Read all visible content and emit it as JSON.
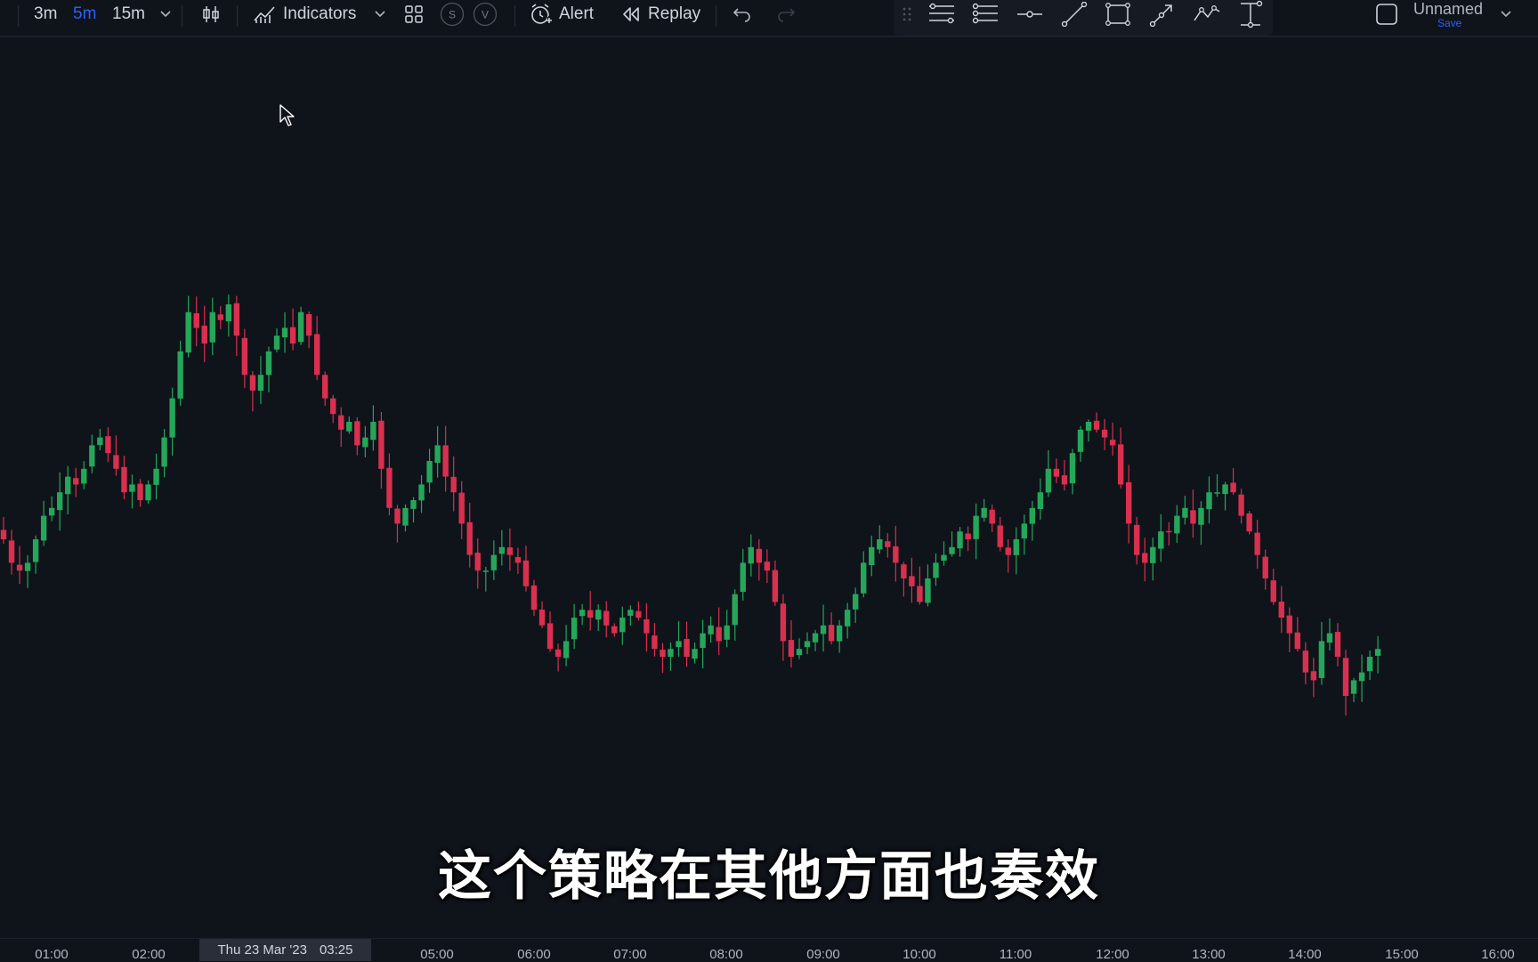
{
  "toolbar": {
    "timeframes": [
      {
        "label": "3m",
        "active": false
      },
      {
        "label": "5m",
        "active": true
      },
      {
        "label": "15m",
        "active": false
      }
    ],
    "indicators_label": "Indicators",
    "alert_label": "Alert",
    "replay_label": "Replay",
    "indicator_badges": [
      "S",
      "V"
    ]
  },
  "drawing_tools": [
    "handle-icon",
    "fib-retracement-icon",
    "pitchfork-icon",
    "horizontal-ray-icon",
    "trend-line-icon",
    "rectangle-icon",
    "arrow-line-icon",
    "path-icon",
    "fixed-range-icon"
  ],
  "layout": {
    "name": "Unnamed",
    "save_label": "Save"
  },
  "colors": {
    "up": "#26a65b",
    "down": "#d9304f",
    "background": "#0f131a",
    "accent": "#2962ff"
  },
  "time_axis": {
    "ticks": [
      "01:00",
      "02:00",
      "05:00",
      "06:00",
      "07:00",
      "08:00",
      "09:00",
      "10:00",
      "11:00",
      "12:00",
      "13:00",
      "14:00",
      "15:00",
      "16:00"
    ],
    "crosshair_date": "Thu 23 Mar '23",
    "crosshair_time": "03:25"
  },
  "subtitle": "这个策略在其他方面也奏效",
  "chart_data": {
    "type": "candlestick",
    "timeframe": "5m",
    "x_start": "00:35",
    "x_step_minutes": 5,
    "close": [
      100,
      97,
      96,
      97,
      100,
      103,
      104,
      106,
      108,
      107,
      109,
      112,
      113,
      111,
      109,
      106,
      107,
      105,
      107,
      109,
      113,
      118,
      124,
      129,
      127,
      125,
      129,
      128,
      130,
      126,
      121,
      119,
      121,
      124,
      126,
      127,
      125,
      129,
      126,
      121,
      118,
      116,
      114,
      115,
      112,
      113,
      115,
      109,
      104,
      102,
      104,
      105,
      107,
      110,
      112,
      108,
      106,
      102,
      98,
      96,
      96,
      98,
      99,
      98,
      97,
      94,
      91,
      89,
      86,
      85,
      87,
      90,
      91,
      90,
      91,
      89,
      88,
      90,
      91,
      90,
      88,
      86,
      85,
      86,
      87,
      85,
      86,
      88,
      89,
      87,
      89,
      93,
      97,
      99,
      97,
      96,
      92,
      87,
      85,
      86,
      87,
      88,
      89,
      87,
      89,
      91,
      93,
      97,
      99,
      100,
      99,
      97,
      95,
      94,
      92,
      95,
      97,
      98,
      99,
      101,
      100,
      103,
      104,
      102,
      99,
      98,
      100,
      102,
      104,
      106,
      109,
      108,
      107,
      111,
      114,
      115,
      114,
      113,
      112,
      107,
      102,
      98,
      97,
      99,
      101,
      101,
      103,
      104,
      102,
      104,
      106,
      106,
      107,
      106,
      103,
      101,
      98,
      95,
      92,
      90,
      88,
      86,
      83,
      82,
      87,
      88,
      85,
      80,
      82,
      83,
      85,
      86
    ],
    "open_rule": "each candle opens near the previous close",
    "title": "",
    "y_scale": "price (arbitrary, no price axis visible)"
  }
}
